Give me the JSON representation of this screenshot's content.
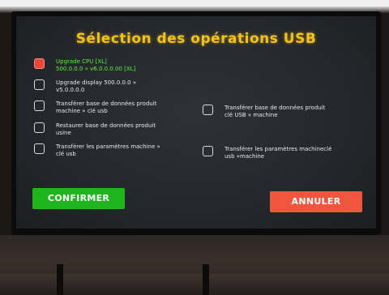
{
  "title": "Sélection des opérations USB",
  "options": [
    {
      "line1": "Upgrade CPU [XL]",
      "line2": "500.0.0.0 » v6.0.0.0.00 [XL]",
      "checked": true
    },
    {
      "line1": "Upgrade display 500.0.0.0 »",
      "line2": "v5.0.0.0.0",
      "checked": false
    },
    {
      "line1": "Transférer base de données produit",
      "line2": "machine » clé usb",
      "checked": false
    },
    {
      "line1": "Restaurer base de données produit",
      "line2": "usine",
      "checked": false
    },
    {
      "line1": "Transférer les paramètres machine »",
      "line2": "clé usb",
      "checked": false
    },
    {
      "line1": "Transférer base de données produit",
      "line2": "clé USB » machine",
      "checked": false
    },
    {
      "line1": "Transférer les paramètres machineclé",
      "line2": "usb »machine",
      "checked": false
    }
  ],
  "buttons": {
    "confirm": "CONFIRMER",
    "cancel": "ANNULER"
  },
  "colors": {
    "title": "#f2c21c",
    "confirm": "#1fb51c",
    "cancel": "#f0553e",
    "checked": "#e8473a",
    "selected_text": "#5ef03c"
  }
}
